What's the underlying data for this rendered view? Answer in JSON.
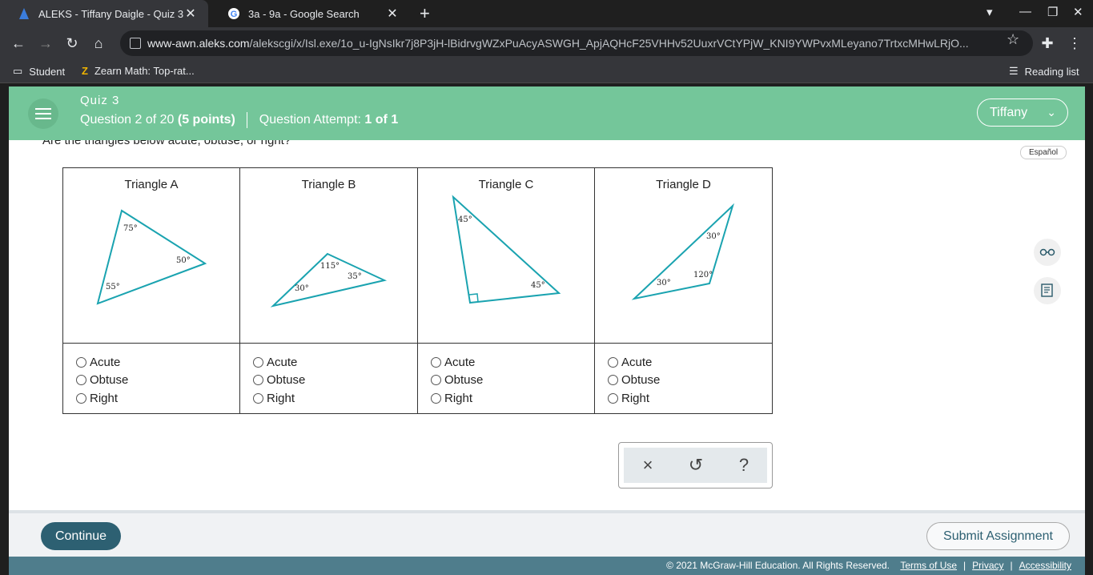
{
  "browser": {
    "tabs": [
      {
        "title": "ALEKS - Tiffany Daigle - Quiz 3",
        "active": true
      },
      {
        "title": "3a - 9a - Google Search",
        "active": false
      }
    ],
    "url_host": "www-awn.aleks.com",
    "url_path": "/alekscgi/x/Isl.exe/1o_u-IgNsIkr7j8P3jH-lBidrvgWZxPuAcyASWGH_ApjAQHcF25VHHv52UuxrVCtYPjW_KNI9YWPvxMLeyano7TrtxcMHwLRjO...",
    "bookmarks": [
      "Student",
      "Zearn Math: Top-rat..."
    ],
    "reading_list": "Reading list"
  },
  "header": {
    "quiz_name": "Quiz 3",
    "question_prefix": "Question 2 of 20",
    "points": "(5 points)",
    "attempt_label": "Question Attempt:",
    "attempt_value": "1 of 1",
    "user": "Tiffany"
  },
  "question": "Are the triangles below acute, obtuse, or right?",
  "espanol": "Español",
  "triangles": [
    {
      "name": "Triangle A",
      "angles": [
        "75°",
        "50°",
        "55°"
      ]
    },
    {
      "name": "Triangle B",
      "angles": [
        "115°",
        "35°",
        "30°"
      ]
    },
    {
      "name": "Triangle C",
      "angles": [
        "45°",
        "45°"
      ]
    },
    {
      "name": "Triangle D",
      "angles": [
        "30°",
        "120°",
        "30°"
      ]
    }
  ],
  "options": [
    "Acute",
    "Obtuse",
    "Right"
  ],
  "answer_tools": {
    "clear": "×",
    "undo": "↺",
    "help": "?"
  },
  "footer": {
    "continue": "Continue",
    "submit": "Submit Assignment",
    "copyright": "© 2021 McGraw-Hill Education. All Rights Reserved.",
    "links": [
      "Terms of Use",
      "Privacy",
      "Accessibility"
    ]
  },
  "colors": {
    "header": "#74c69a",
    "triangle_stroke": "#1aa3b0",
    "continue": "#2d6072"
  }
}
